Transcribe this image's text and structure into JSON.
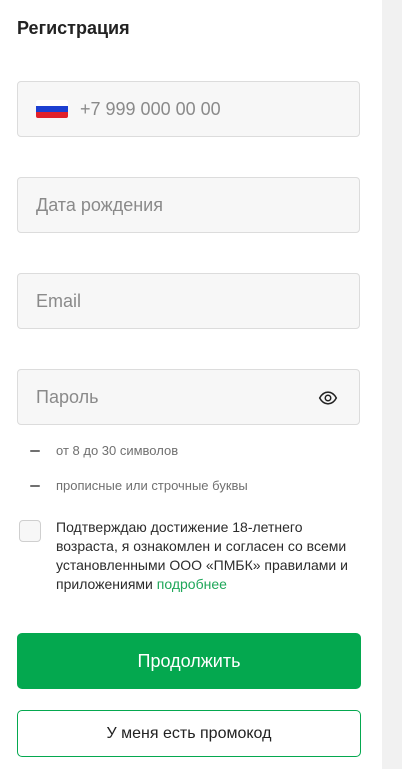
{
  "form": {
    "title": "Регистрация",
    "phone": {
      "placeholder": "+7 999 000 00 00",
      "flag_icon": "russia-flag-icon",
      "flag_colors": [
        "#ffffff",
        "#1c3fd1",
        "#e1202a"
      ]
    },
    "birthdate": {
      "placeholder": "Дата рождения"
    },
    "email": {
      "placeholder": "Email"
    },
    "password": {
      "placeholder": "Пароль",
      "toggle_icon": "eye-icon"
    },
    "password_rules": [
      "от 8 до 30 символов",
      "прописные или строчные буквы"
    ],
    "consent": {
      "checked": false,
      "text": "Подтверждаю достижение 18-летнего возраста, я ознакомлен и согласен со всеми установленными ООО «ПМБК» правилами и приложениями",
      "link": "подробнее"
    },
    "continue_label": "Продолжить",
    "promo_label": "У меня есть промокод"
  },
  "colors": {
    "accent": "#04a84f",
    "link": "#1fa75a",
    "field_bg": "#f7f7f7",
    "placeholder": "#8a8a8a"
  }
}
